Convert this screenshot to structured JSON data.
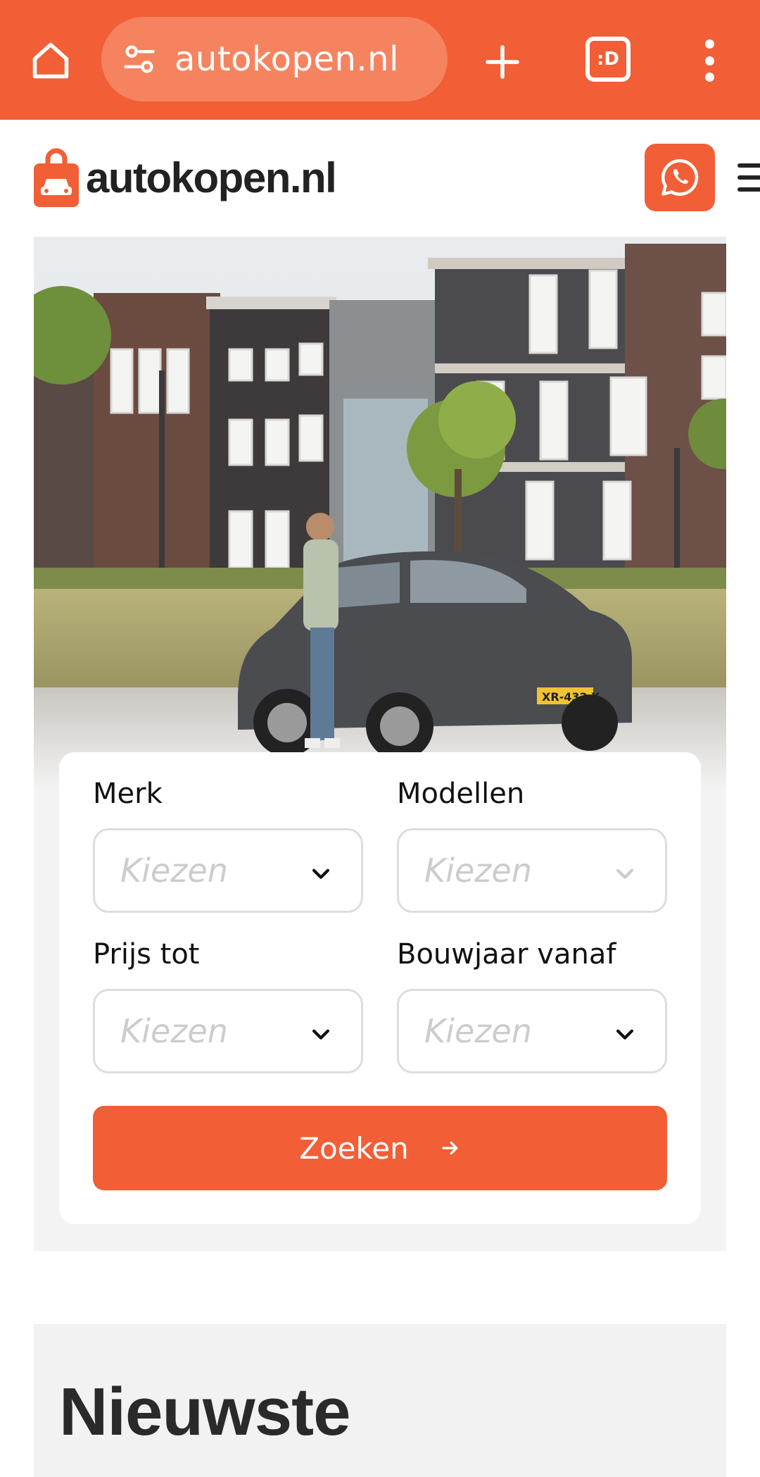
{
  "browser": {
    "url": "autokopen.nl",
    "tabs_label": ":D"
  },
  "header": {
    "logo_text": "autokopen.nl"
  },
  "search": {
    "fields": [
      {
        "label": "Merk",
        "placeholder": "Kiezen",
        "enabled": true
      },
      {
        "label": "Modellen",
        "placeholder": "Kiezen",
        "enabled": false
      },
      {
        "label": "Prijs tot",
        "placeholder": "Kiezen",
        "enabled": true
      },
      {
        "label": "Bouwjaar vanaf",
        "placeholder": "Kiezen",
        "enabled": true
      }
    ],
    "button_label": "Zoeken"
  },
  "hero": {
    "plate": "XR-432-X"
  },
  "latest": {
    "title": "Nieuwste"
  },
  "colors": {
    "brand": "#f25e36",
    "text": "#222222"
  },
  "icons": [
    "home-icon",
    "tune-icon",
    "plus-icon",
    "tab-switcher-icon",
    "more-vert-icon",
    "shopping-bag-car-icon",
    "whatsapp-icon",
    "hamburger-menu-icon",
    "chevron-down-icon",
    "arrow-right-icon"
  ]
}
